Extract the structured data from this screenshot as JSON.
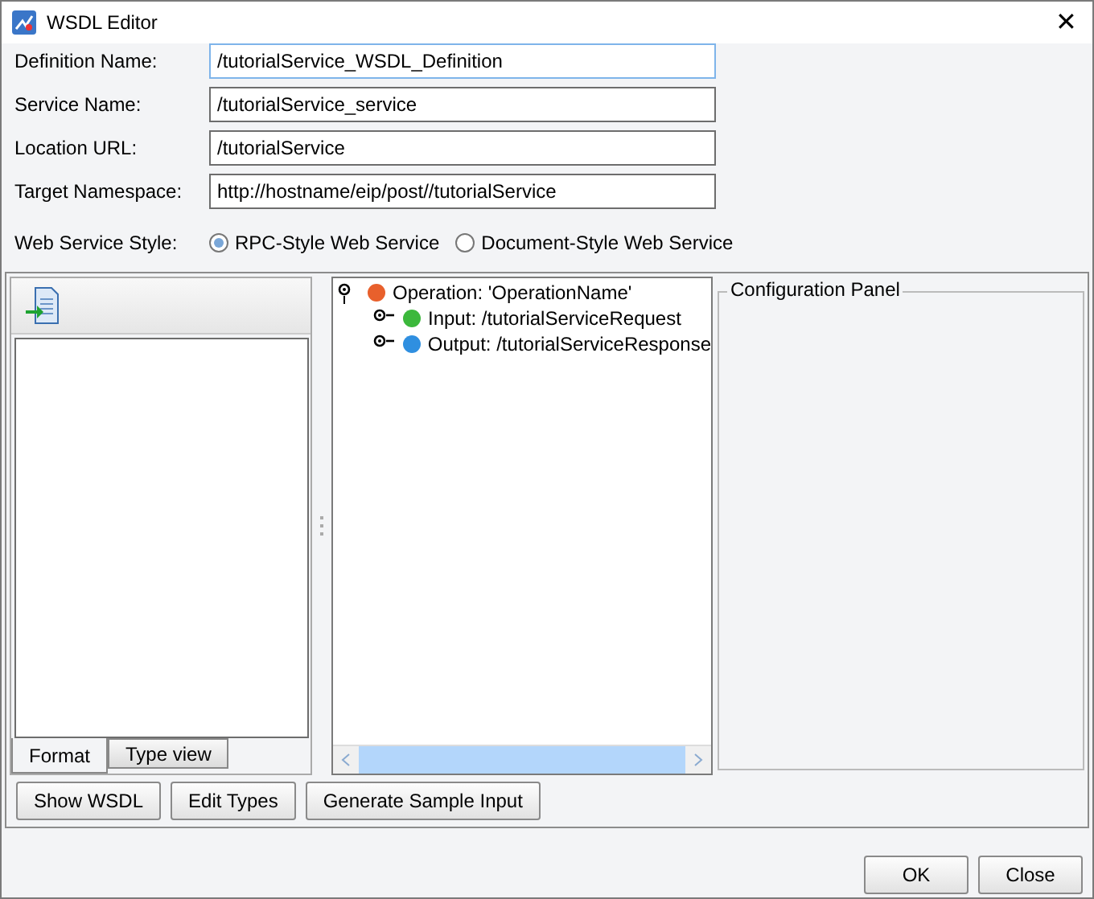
{
  "window": {
    "title": "WSDL Editor",
    "close": "✕"
  },
  "fields": [
    {
      "label": "Definition Name:",
      "value": "/tutorialService_WSDL_Definition",
      "focused": true
    },
    {
      "label": "Service Name:",
      "value": "/tutorialService_service",
      "focused": false
    },
    {
      "label": "Location URL:",
      "value": "/tutorialService",
      "focused": false
    },
    {
      "label": "Target Namespace:",
      "value": "http://hostname/eip/post//tutorialService",
      "focused": false
    }
  ],
  "style": {
    "label": "Web Service Style:",
    "options": [
      {
        "label": "RPC-Style Web Service",
        "selected": true
      },
      {
        "label": "Document-Style Web Service",
        "selected": false
      }
    ]
  },
  "left_tabs": [
    {
      "label": "Format",
      "selected": true
    },
    {
      "label": "Type view",
      "selected": false
    }
  ],
  "tree": [
    {
      "label": "Operation: 'OperationName'",
      "color": "#e8602c",
      "expanded": true,
      "children": [
        {
          "label": "Input: /tutorialServiceRequest",
          "color": "#3cb83c",
          "expanded": false
        },
        {
          "label": "Output: /tutorialServiceResponse",
          "color": "#2f8fe0",
          "expanded": false
        }
      ]
    }
  ],
  "config_panel": {
    "title": "Configuration Panel"
  },
  "actions": [
    "Show WSDL",
    "Edit Types",
    "Generate Sample Input"
  ],
  "buttons": [
    "OK",
    "Close"
  ]
}
